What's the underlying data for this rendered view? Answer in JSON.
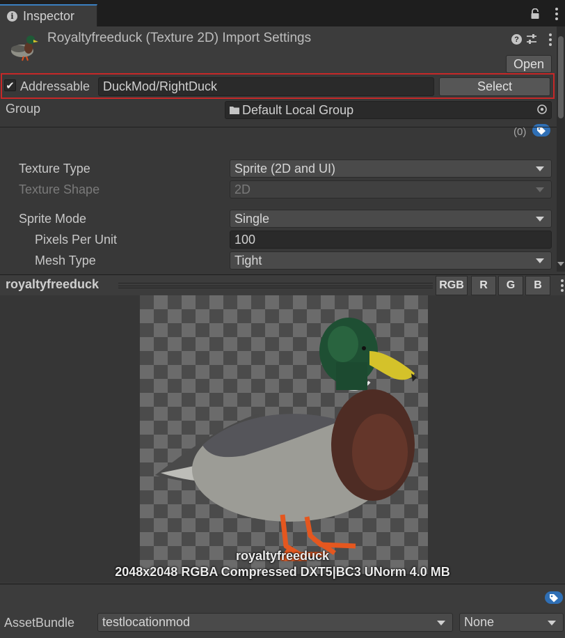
{
  "window": {
    "tab_label": "Inspector"
  },
  "header": {
    "title": "Royaltyfreeduck (Texture 2D) Import Settings",
    "open_label": "Open",
    "help_glyph": "?"
  },
  "addressable": {
    "checkbox_label": "Addressable",
    "checked": true,
    "address_value": "DuckMod/RightDuck",
    "select_label": "Select",
    "group_label": "Group",
    "group_value": "Default Local Group",
    "labels_count": "(0)"
  },
  "settings": {
    "texture_type_label": "Texture Type",
    "texture_type_value": "Sprite (2D and UI)",
    "texture_shape_label": "Texture Shape",
    "texture_shape_value": "2D",
    "sprite_mode_label": "Sprite Mode",
    "sprite_mode_value": "Single",
    "pixels_per_unit_label": "Pixels Per Unit",
    "pixels_per_unit_value": "100",
    "mesh_type_label": "Mesh Type",
    "mesh_type_value": "Tight"
  },
  "preview": {
    "title": "royaltyfreeduck",
    "channels": [
      "RGB",
      "R",
      "G",
      "B"
    ],
    "caption_name": "royaltyfreeduck",
    "caption_info": "2048x2048  RGBA Compressed DXT5|BC3 UNorm   4.0 MB"
  },
  "asset_bundle": {
    "label": "AssetBundle",
    "bundle_value": "testlocationmod",
    "variant_value": "None"
  },
  "icons": [
    "info-icon",
    "lock-icon",
    "kebab-menu-icon",
    "duck-thumbnail-icon",
    "help-icon",
    "sliders-icon",
    "checkmark-icon",
    "folder-icon",
    "object-picker-icon",
    "tag-icon",
    "chevron-down-icon"
  ],
  "colors": {
    "highlight_border": "#c62828",
    "tag_badge": "#2f6fb5",
    "panel_bg": "#383838"
  }
}
